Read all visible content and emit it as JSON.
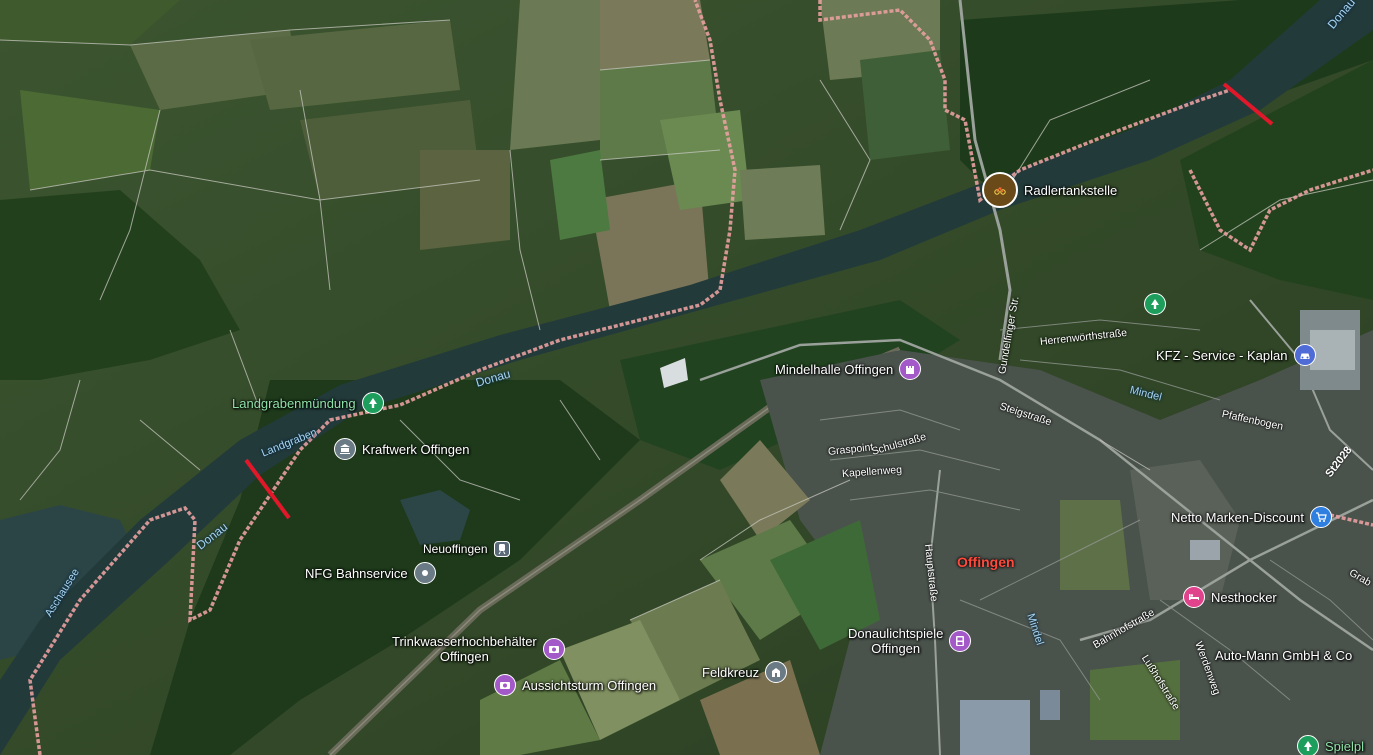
{
  "map": {
    "colors": {
      "field_dark": "#2f4a22",
      "field_light": "#5c6b3e",
      "forest": "#1f3a1a",
      "river": "#233a3b",
      "boundary": "#e8a0a0",
      "closure": "#e0182a",
      "town": "#4b5350"
    },
    "pois": [
      {
        "id": "radler",
        "label": "Radlertankstelle",
        "icon": "bicycle-photo-icon",
        "color": "#ffffff"
      },
      {
        "id": "landgraben",
        "label": "Landgrabenmündung",
        "icon": "tree-icon",
        "color": "#1e9e5c",
        "green": true
      },
      {
        "id": "kraftwerk",
        "label": "Kraftwerk Offingen",
        "icon": "landmark-icon",
        "color": "#6b7b86"
      },
      {
        "id": "neuoffingen",
        "label": "Neuoffingen",
        "icon": "train-icon",
        "color": "#5a6a78"
      },
      {
        "id": "nfg",
        "label": "NFG Bahnservice",
        "icon": "pin-icon",
        "color": "#6b7b86"
      },
      {
        "id": "mindelhalle",
        "label": "Mindelhalle Offingen",
        "icon": "castle-icon",
        "color": "#a35ac8"
      },
      {
        "id": "trinkwasser",
        "label": "Trinkwasserhochbehälter\nOffingen",
        "icon": "camera-icon",
        "color": "#a35ac8"
      },
      {
        "id": "aussichtsturm",
        "label": "Aussichtsturm Offingen",
        "icon": "camera-icon",
        "color": "#a35ac8"
      },
      {
        "id": "feldkreuz",
        "label": "Feldkreuz",
        "icon": "church-icon",
        "color": "#6b7b86"
      },
      {
        "id": "donaulicht",
        "label": "Donaulichtspiele\nOffingen",
        "icon": "cinema-icon",
        "color": "#a35ac8"
      },
      {
        "id": "kfz",
        "label": "KFZ - Service - Kaplan",
        "icon": "car-icon",
        "color": "#4f6bd6"
      },
      {
        "id": "netto",
        "label": "Netto Marken-Discount",
        "icon": "cart-icon",
        "color": "#2f7fe0"
      },
      {
        "id": "nesthocker",
        "label": "Nesthocker",
        "icon": "bed-icon",
        "color": "#e0428c"
      },
      {
        "id": "automann",
        "label": "Auto-Mann GmbH & Co",
        "icon": "",
        "color": ""
      },
      {
        "id": "park",
        "label": "",
        "icon": "tree-icon",
        "color": "#1e9e5c"
      },
      {
        "id": "spielplatz",
        "label": "Spielpl",
        "icon": "tree-icon",
        "color": "#1e9e5c",
        "green": true
      }
    ],
    "town_label": "Offingen",
    "water_labels": [
      "Donau",
      "Donau",
      "Donau",
      "Landgraben",
      "Aschausee",
      "Mindel",
      "Mindel"
    ],
    "streets": [
      "Gundelfinger Str.",
      "Herrenwörthstraße",
      "Pfaffenbogen",
      "Steigstraße",
      "Graspoint",
      "Schulstraße",
      "Kapellenweg",
      "Hauptstraße",
      "Bahnhofstraße",
      "Lußhofstraße",
      "Werdenweg",
      "Grab"
    ],
    "road_number": "St2028"
  }
}
